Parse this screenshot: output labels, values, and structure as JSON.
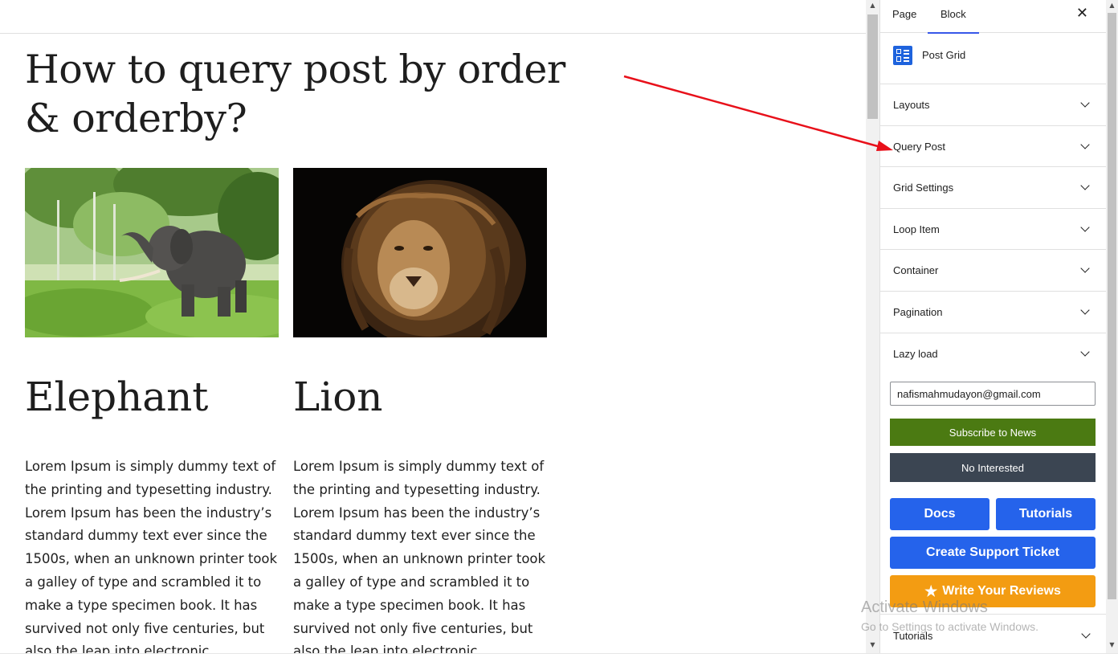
{
  "post": {
    "title": "How to query post by order & orderby?",
    "cards": [
      {
        "title": "Elephant",
        "image": "elephant-photo",
        "excerpt": "Lorem Ipsum is simply dummy text of the printing and typesetting industry. Lorem Ipsum has been the industry’s standard dummy text ever since the 1500s, when an unknown printer took a galley of type and scrambled it to make a type specimen book. It has survived not only five centuries, but also the leap into electronic typesetting"
      },
      {
        "title": "Lion",
        "image": "lion-photo",
        "excerpt": "Lorem Ipsum is simply dummy text of the printing and typesetting industry. Lorem Ipsum has been the industry’s standard dummy text ever since the 1500s, when an unknown printer took a galley of type and scrambled it to make a type specimen book. It has survived not only five centuries, but also the leap into electronic typesetting"
      }
    ]
  },
  "sidebar": {
    "tabs": {
      "page": "Page",
      "block": "Block"
    },
    "close": "✕",
    "block_name": "Post Grid",
    "panels": [
      "Layouts",
      "Query Post",
      "Grid Settings",
      "Loop Item",
      "Container",
      "Pagination",
      "Lazy load"
    ],
    "promo": {
      "email_value": "nafismahmudayon@gmail.com",
      "subscribe": "Subscribe to News",
      "not_interested": "No Interested",
      "docs": "Docs",
      "tutorials": "Tutorials",
      "support": "Create Support Ticket",
      "reviews": "Write Your Reviews"
    },
    "bottom_panel": "Tutorials"
  },
  "watermark": {
    "title": "Activate Windows",
    "subtitle": "Go to Settings to activate Windows."
  },
  "colors": {
    "accent": "#3858e9",
    "primary_button": "#2563eb",
    "subscribe": "#4b7a12",
    "not_interested": "#3b4552",
    "reviews": "#f39c12",
    "annotation_arrow": "#e8101a"
  }
}
